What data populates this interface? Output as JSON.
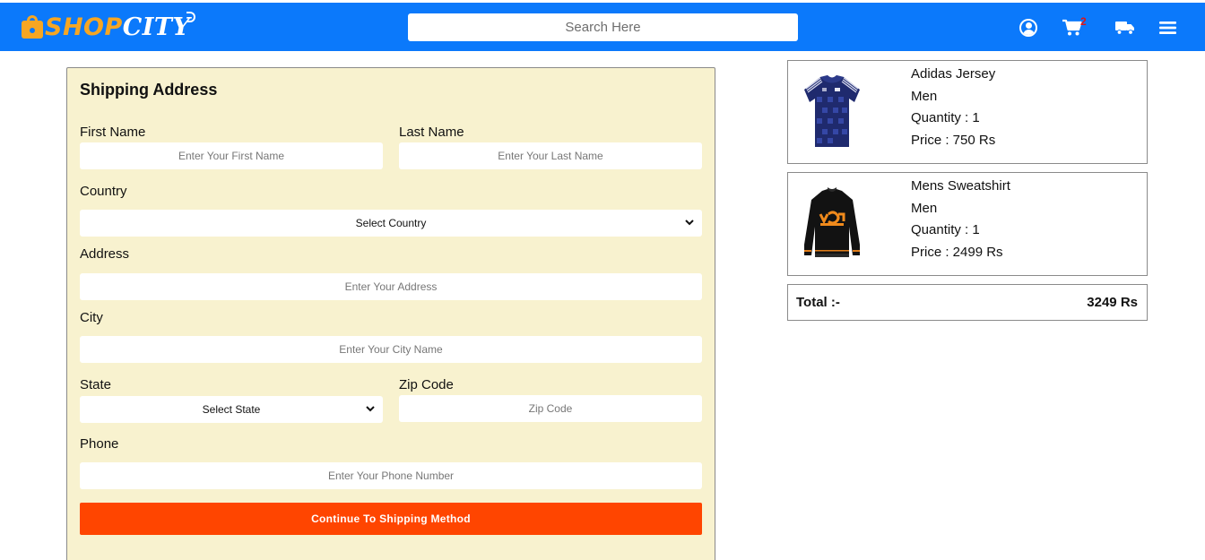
{
  "brand": {
    "logo_shop": "SHOP",
    "logo_city": "CITY",
    "color_primary": "#0b79fb",
    "color_logo_accent": "#f6a623"
  },
  "header": {
    "search_placeholder": "Search Here",
    "icons": [
      "user-circle-icon",
      "cart-icon",
      "truck-icon",
      "hamburger-menu-icon"
    ],
    "cart_count": "2",
    "cart_count_color": "#e01414"
  },
  "shipping_form": {
    "title": "Shipping Address",
    "background": "#f8f2cf",
    "first_name": {
      "label": "First Name",
      "placeholder": "Enter Your First Name",
      "value": ""
    },
    "last_name": {
      "label": "Last Name",
      "placeholder": "Enter Your Last Name",
      "value": ""
    },
    "country": {
      "label": "Country",
      "selected": "Select Country"
    },
    "address": {
      "label": "Address",
      "placeholder": "Enter Your Address",
      "value": ""
    },
    "city": {
      "label": "City",
      "placeholder": "Enter Your City Name",
      "value": ""
    },
    "state": {
      "label": "State",
      "selected": "Select State"
    },
    "zip": {
      "label": "Zip Code",
      "placeholder": "Zip Code",
      "value": ""
    },
    "phone": {
      "label": "Phone",
      "placeholder": "Enter Your Phone Number",
      "value": ""
    },
    "submit_label": "Continue To Shipping Method",
    "submit_color": "#ff4500"
  },
  "cart": {
    "items": [
      {
        "name": "Adidas Jersey",
        "category": "Men",
        "quantity": "Quantity : 1",
        "price": "Price : 750 Rs",
        "image_icon": "blue-jersey-image"
      },
      {
        "name": "Mens Sweatshirt",
        "category": "Men",
        "quantity": "Quantity : 1",
        "price": "Price : 2499 Rs",
        "image_icon": "black-sweatshirt-image"
      }
    ],
    "total_label": "Total :-",
    "total_value": "3249 Rs"
  }
}
